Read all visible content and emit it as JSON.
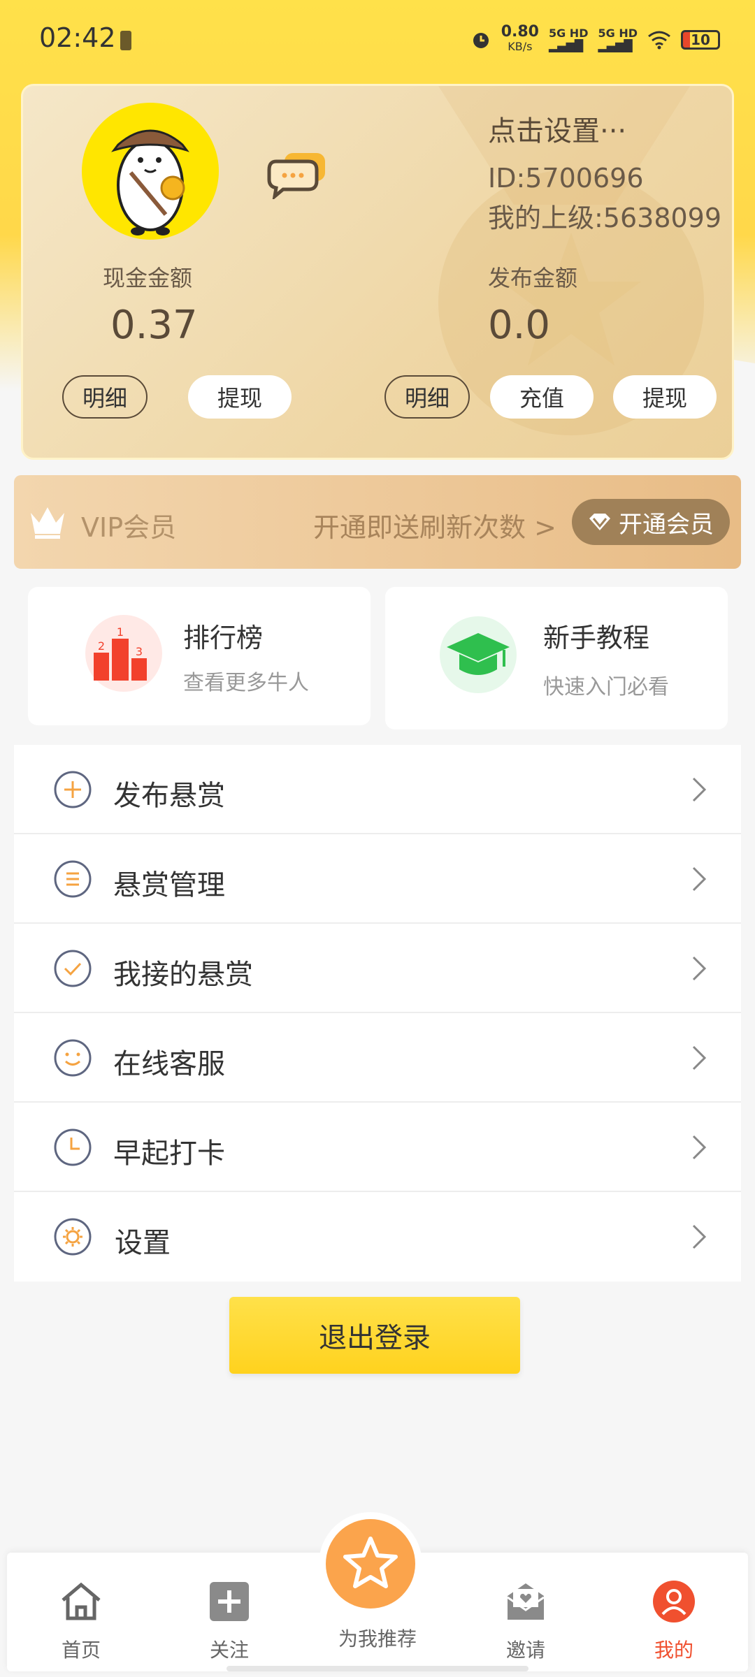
{
  "status_bar": {
    "time": "02:42",
    "net_speed": "0.80",
    "net_unit": "KB/s",
    "signal_1": "5G HD",
    "signal_2": "5G HD",
    "battery": "10"
  },
  "profile": {
    "nickname": "点击设置···",
    "id_text": "ID:5700696",
    "parent_text": "我的上级:5638099",
    "cash_label": "现金金额",
    "cash_value": "0.37",
    "publish_label": "发布金额",
    "publish_value": "0.0",
    "buttons": {
      "cash_detail": "明细",
      "cash_withdraw": "提现",
      "pub_detail": "明细",
      "pub_recharge": "充值",
      "pub_withdraw": "提现"
    }
  },
  "vip": {
    "title": "VIP会员",
    "promo": "开通即送刷新次数 >",
    "button": "开通会员"
  },
  "features": [
    {
      "title": "排行榜",
      "subtitle": "查看更多牛人",
      "icon": "podium-icon"
    },
    {
      "title": "新手教程",
      "subtitle": "快速入门必看",
      "icon": "graduation-cap-icon"
    }
  ],
  "menu": [
    {
      "label": "发布悬赏",
      "icon": "plus-circle-icon"
    },
    {
      "label": "悬赏管理",
      "icon": "list-circle-icon"
    },
    {
      "label": "我接的悬赏",
      "icon": "check-circle-icon"
    },
    {
      "label": "在线客服",
      "icon": "smile-circle-icon"
    },
    {
      "label": "早起打卡",
      "icon": "clock-icon"
    },
    {
      "label": "设置",
      "icon": "gear-icon"
    }
  ],
  "logout": "退出登录",
  "nav": {
    "home": "首页",
    "follow": "关注",
    "recommend": "为我推荐",
    "invite": "邀请",
    "mine": "我的",
    "active_color": "#f0502f"
  },
  "colors": {
    "accent_yellow": "#ffd84a",
    "vip_button": "#a08158",
    "icon_orange": "#f5a341"
  }
}
